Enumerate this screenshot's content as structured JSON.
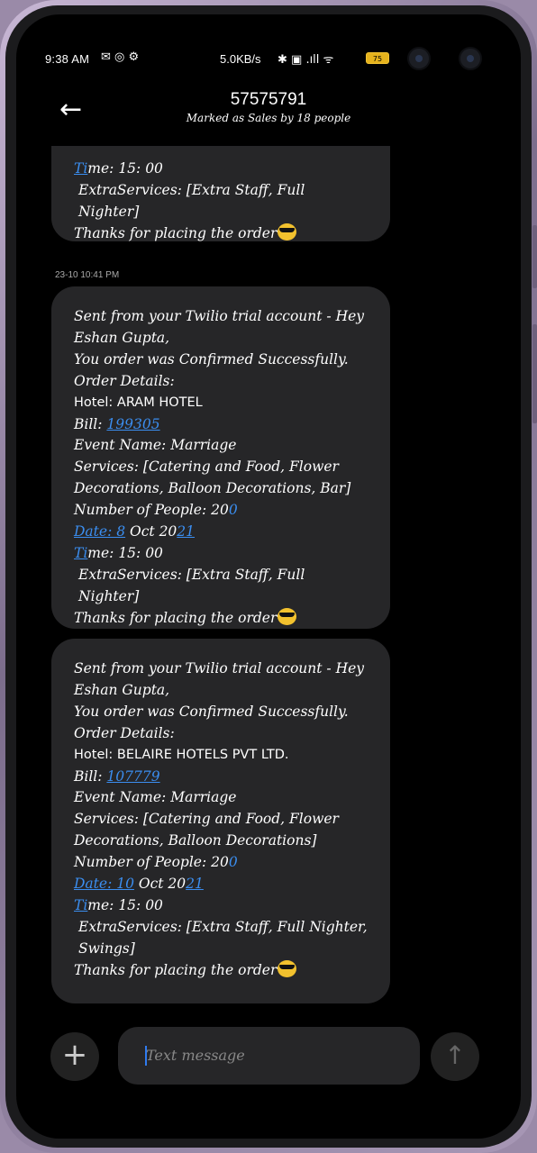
{
  "status_bar": {
    "time": "9:38 AM",
    "left_icons": "✉ ◎ ⚙",
    "network_speed": "5.0KB/s",
    "right_icons": "✱ ▣ .ıll ᯤ",
    "battery_level": "75"
  },
  "header": {
    "title": "57575791",
    "subtitle": "Marked as Sales by 18 people"
  },
  "messages": [
    {
      "time_partial": "15:00",
      "extra_services": "ExtraServices: [Extra Staff,  Full Nighter]",
      "closing": "Thanks for placing the order"
    },
    {
      "timestamp": "23-10 10:41 PM",
      "intro": "Sent from your Twilio trial account - Hey Eshan Gupta,",
      "status_line": "You order was Confirmed Successfully.",
      "details_label": "Order Details:",
      "hotel": "Hotel: ARAM HOTEL",
      "bill_label": "Bill: ",
      "bill_number": "199305",
      "event_name": "Event Name:  Marriage",
      "services": "Services:  [Catering and Food,  Flower Decorations,  Balloon Decorations,  Bar]",
      "people_label": "Number of People:  20",
      "people_link": "0",
      "date_link": "Date:  8",
      "date_mid": " Oct 20",
      "date_year_link": "21",
      "time_prefix_link": "Ti",
      "time_rest": "me:  15: 00",
      "extra_services": "ExtraServices: [Extra Staff,  Full Nighter]",
      "closing": "Thanks for placing the order"
    },
    {
      "intro": "Sent from your Twilio trial account - Hey Eshan Gupta,",
      "status_line": "You order was Confirmed Successfully.",
      "details_label": "Order Details:",
      "hotel": "Hotel: BELAIRE HOTELS PVT LTD.",
      "bill_label": "Bill: ",
      "bill_number": "107779",
      "event_name": "Event Name:  Marriage",
      "services": "Services:  [Catering and Food,  Flower Decorations,  Balloon Decorations]",
      "people_label": "Number of People:  20",
      "people_link": "0",
      "date_link": "Date:  10",
      "date_mid": " Oct 20",
      "date_year_link": "21",
      "time_prefix_link": "Ti",
      "time_rest": "me:  15: 00",
      "extra_services": "ExtraServices: [Extra Staff,  Full Nighter,  Swings]",
      "closing": "Thanks for placing the order"
    }
  ],
  "composer": {
    "placeholder": "Text message",
    "add_icon": "plus-icon",
    "send_icon": "arrow-up-icon"
  },
  "colors": {
    "link": "#3b8ef0",
    "bubble": "#262628",
    "background": "#000000",
    "caret": "#2f7bef"
  }
}
